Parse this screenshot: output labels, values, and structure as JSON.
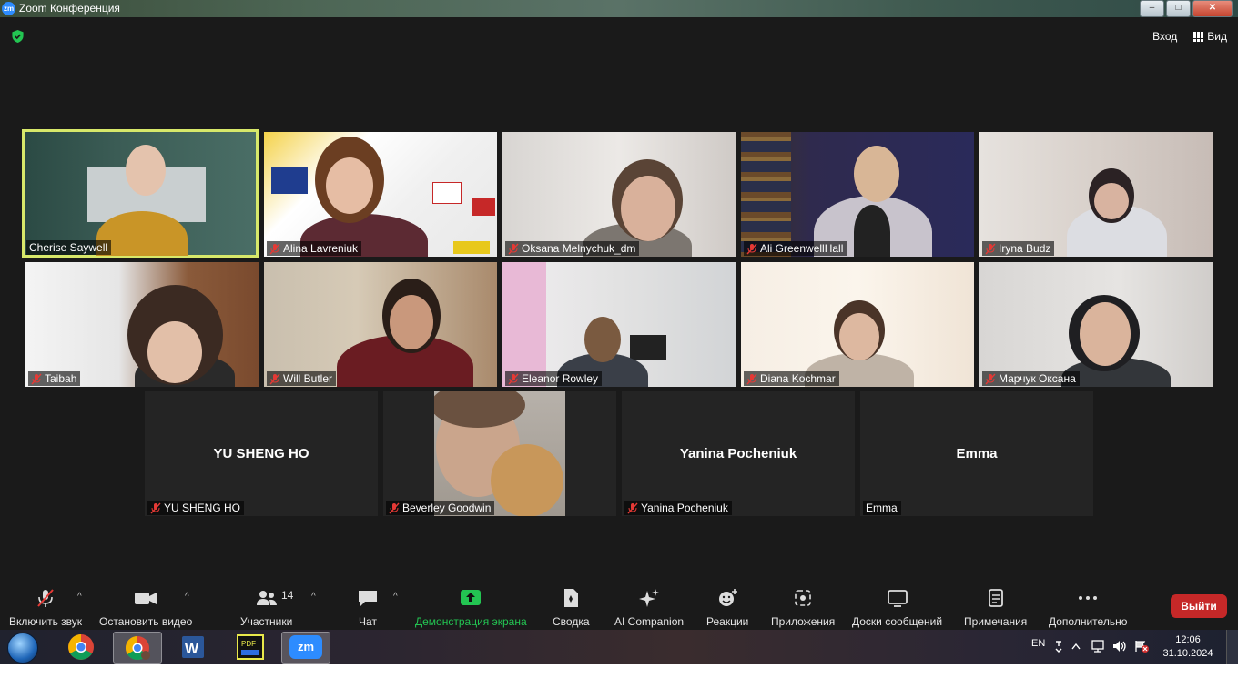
{
  "window": {
    "title": "Zoom Конференция",
    "min": "‒",
    "max": "□",
    "close": "✕"
  },
  "top_controls": {
    "enter_label": "Вход",
    "view_label": "Вид"
  },
  "participants": [
    {
      "name": "Cherise Saywell",
      "muted": false,
      "active_speaker": true
    },
    {
      "name": "Alina Lavreniuk",
      "muted": true
    },
    {
      "name": "Oksana Melnychuk_dm",
      "muted": true
    },
    {
      "name": "Ali GreenwellHall",
      "muted": true
    },
    {
      "name": "Iryna Budz",
      "muted": true
    },
    {
      "name": "Taibah",
      "muted": true
    },
    {
      "name": "Will Butler",
      "muted": true
    },
    {
      "name": "Eleanor Rowley",
      "muted": true
    },
    {
      "name": "Diana Kochmar",
      "muted": true
    },
    {
      "name": "Марчук Оксана",
      "muted": true
    },
    {
      "name": "YU SHENG HO",
      "display_name": "YU SHENG HO",
      "muted": true,
      "video_off": true
    },
    {
      "name": "Beverley Goodwin",
      "muted": true
    },
    {
      "name": "Yanina Pocheniuk",
      "display_name": "Yanina Pocheniuk",
      "muted": true,
      "video_off": true
    },
    {
      "name": "Emma",
      "display_name": "Emma",
      "muted": false,
      "video_off": true
    }
  ],
  "toolbar": {
    "unmute": "Включить звук",
    "stop_video": "Остановить видео",
    "participants": "Участники",
    "participants_count": "14",
    "chat": "Чат",
    "share_screen": "Демонстрация экрана",
    "summary": "Сводка",
    "ai_companion": "AI Companion",
    "reactions": "Реакции",
    "apps": "Приложения",
    "whiteboards": "Доски сообщений",
    "notes": "Примечания",
    "more": "Дополнительно",
    "leave": "Выйти",
    "caret": "^"
  },
  "taskbar": {
    "language": "EN",
    "time": "12:06",
    "date": "31.10.2024",
    "apps": [
      "chrome-icon",
      "chrome-profile-icon",
      "word-icon",
      "pdf-icon",
      "zoom-icon"
    ],
    "zoom_label": "zm"
  },
  "colors": {
    "accent_green": "#23c552",
    "active_outline": "#d7e86a",
    "leave_red": "#c62828",
    "muted_red": "#e53935"
  }
}
